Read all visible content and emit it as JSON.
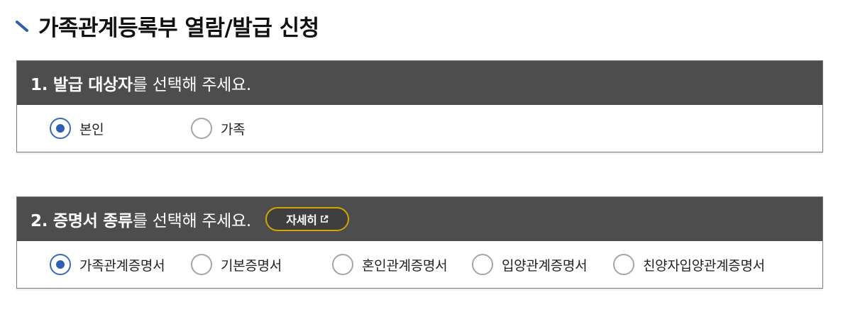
{
  "page": {
    "title": "가족관계등록부 열람/발급 신청"
  },
  "section1": {
    "header_bold": "1. 발급 대상자",
    "header_rest": "를 선택해 주세요.",
    "options": [
      {
        "label": "본인",
        "checked": true
      },
      {
        "label": "가족",
        "checked": false
      }
    ]
  },
  "section2": {
    "header_bold": "2. 증명서 종류",
    "header_rest": "를 선택해 주세요.",
    "detail_button": "자세히",
    "options": [
      {
        "label": "가족관계증명서",
        "checked": true
      },
      {
        "label": "기본증명서",
        "checked": false
      },
      {
        "label": "혼인관계증명서",
        "checked": false
      },
      {
        "label": "입양관계증명서",
        "checked": false
      },
      {
        "label": "친양자입양관계증명서",
        "checked": false
      }
    ]
  },
  "colors": {
    "header_bg": "#4d4d4d",
    "radio_selected": "#2f5fb0",
    "detail_border": "#d4a500",
    "title_mark": "#2f5fb0"
  }
}
